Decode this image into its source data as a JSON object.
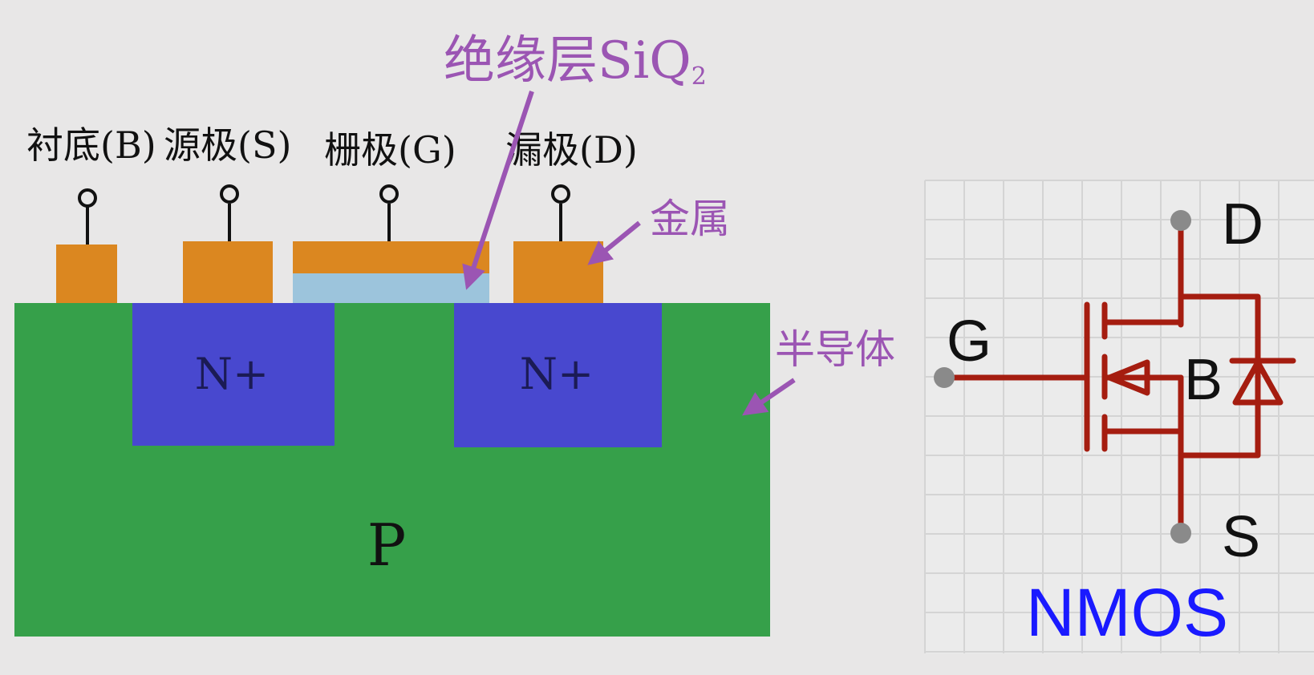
{
  "cross_section": {
    "terminals": {
      "substrate": "衬底(B)",
      "source": "源极(S)",
      "gate": "栅极(G)",
      "drain": "漏极(D)"
    },
    "callouts": {
      "insulator": "绝缘层SiQ",
      "insulator_subscript": "2",
      "metal": "金属",
      "semiconductor": "半导体"
    },
    "regions": {
      "source_well": "N+",
      "drain_well": "N+",
      "substrate": "P"
    },
    "colors": {
      "metal": "#db8720",
      "oxide": "#9cc4dc",
      "n_plus": "#4848cf",
      "p_substrate": "#36a04a",
      "callout": "#9b55b3"
    }
  },
  "symbol": {
    "pins": {
      "drain": "D",
      "gate": "G",
      "body": "B",
      "source": "S"
    },
    "title": "NMOS",
    "colors": {
      "wire": "#a51d10",
      "pin": "#8a8a8a",
      "title": "#1a1aff",
      "grid": "#d4d4d4"
    }
  }
}
